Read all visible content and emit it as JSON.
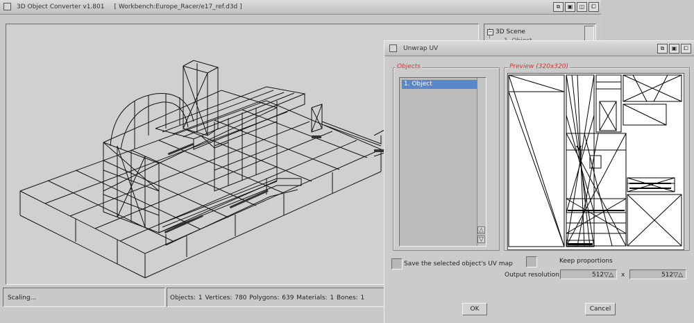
{
  "main_window": {
    "title": "3D Object Converter v1.801",
    "path": "[ Workbench:Europe_Racer/e17_ref.d3d ]",
    "title_buttons": [
      "depth-icon",
      "zoom-icon",
      "iconify-icon",
      "screen-icon"
    ]
  },
  "scene_tree": {
    "root_label": "3D Scene",
    "expander": "−",
    "child_label": "1. Object"
  },
  "status": {
    "left": "Scaling...",
    "right": "Objects: 1  Vertices: 780  Polygons: 639  Materials: 1  Bones: 1"
  },
  "dialog": {
    "title": "Unwrap UV",
    "objects_group_title": "Objects",
    "preview_group_title": "Preview (320x320)",
    "objects": [
      "1.  Object"
    ],
    "save_uv_label": "Save the selected object's UV map",
    "keep_proportions_label": "Keep proportions",
    "output_resolution_label": "Output resolution:",
    "res_width": "512▽△",
    "res_times": "x",
    "res_height": "512▽△",
    "ok_label": "OK",
    "cancel_label": "Cancel",
    "scroll_up": "△",
    "scroll_down": "▽"
  },
  "colors": {
    "accent_selection": "#5a87cc",
    "group_title": "#e0302a"
  }
}
